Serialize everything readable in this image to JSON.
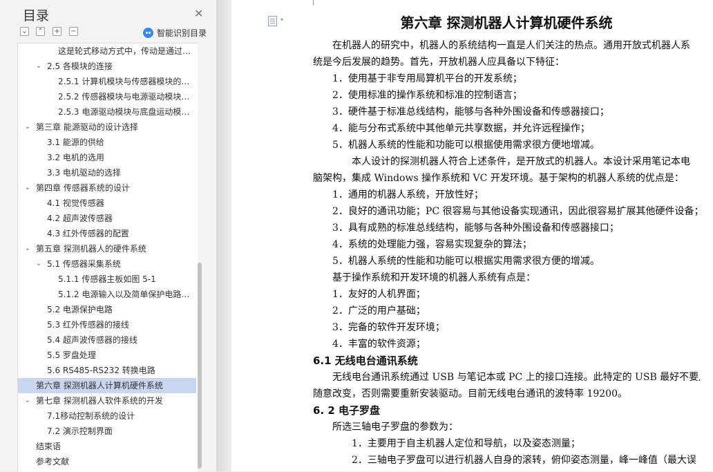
{
  "sidebar": {
    "title": "目录",
    "smart_identify_label": "智能识别目录",
    "tool_icons": [
      "collapse-all-icon",
      "expand-all-icon",
      "add-icon",
      "remove-icon"
    ],
    "items": [
      {
        "label": "这是轮式移动方式中，传动是通过…",
        "level": 3,
        "arrow": ""
      },
      {
        "label": "2.5  各模块的连接",
        "level": 1,
        "arrow": "v"
      },
      {
        "label": "2.5.1  计算机模块与传感器模块的…",
        "level": 2,
        "arrow": ""
      },
      {
        "label": "2.5.2  传感器模块与电源驱动模块…",
        "level": 2,
        "arrow": ""
      },
      {
        "label": "2.5.3 电源驱动模块与底盘运动模…",
        "level": 2,
        "arrow": ""
      },
      {
        "label": "第三章   能源驱动的设计选择",
        "level": 0,
        "arrow": "v"
      },
      {
        "label": "3.1 能源的供给",
        "level": 1,
        "arrow": ""
      },
      {
        "label": "3.2 电机的选用",
        "level": 1,
        "arrow": ""
      },
      {
        "label": "3.3 电机驱动的选择",
        "level": 1,
        "arrow": ""
      },
      {
        "label": "第四章    传感器系统的设计",
        "level": 0,
        "arrow": "v"
      },
      {
        "label": "4.1 视觉传感器",
        "level": 1,
        "arrow": ""
      },
      {
        "label": "4.2 超声波传感器",
        "level": 1,
        "arrow": ""
      },
      {
        "label": "4.3 红外传感器的配置",
        "level": 1,
        "arrow": ""
      },
      {
        "label": "第五章  探测机器人的硬件系统",
        "level": 0,
        "arrow": "v"
      },
      {
        "label": "5.1  传感器采集系统",
        "level": 1,
        "arrow": "v"
      },
      {
        "label": "5.1.1  传感器主板如图 5-1",
        "level": 2,
        "arrow": ""
      },
      {
        "label": "5.1.2  电源输入以及简单保护电路…",
        "level": 2,
        "arrow": ""
      },
      {
        "label": "5.2 电源保护电路",
        "level": 1,
        "arrow": ""
      },
      {
        "label": "5.3 红外传感器的接线",
        "level": 1,
        "arrow": ""
      },
      {
        "label": "5.4 超声波传感器的接线",
        "level": 1,
        "arrow": ""
      },
      {
        "label": "5.5 罗盘处理",
        "level": 1,
        "arrow": ""
      },
      {
        "label": "5.6 RS485-RS232 转换电路",
        "level": 1,
        "arrow": ""
      },
      {
        "label": "第六章  探测机器人计算机硬件系统",
        "level": 0,
        "arrow": "",
        "selected": true
      },
      {
        "label": "第七章    探测机器人软件系统的开发",
        "level": 0,
        "arrow": "v"
      },
      {
        "label": "7.1移动控制系统的设计",
        "level": 1,
        "arrow": ""
      },
      {
        "label": "7.2 演示控制界面",
        "level": 1,
        "arrow": ""
      },
      {
        "label": "结束语",
        "level": 0,
        "arrow": ""
      },
      {
        "label": "参考文献",
        "level": 0,
        "arrow": ""
      }
    ]
  },
  "document": {
    "chapter_title": "第六章  探测机器人计算机硬件系统",
    "lines": [
      {
        "text": "在机器人的研究中，机器人的系统结构一直是人们关注的热点。通用开放式机器人系",
        "indent": 1
      },
      {
        "text": "统是今后发展的趋势。首先，开放机器人应具备以下特征：",
        "indent": 0
      },
      {
        "text": "1．使用基于非专用局算机平台的开发系统；",
        "indent": 1
      },
      {
        "text": "2．使用标准的操作系统和标准的控制语言；",
        "indent": 1
      },
      {
        "text": "3．硬件基于标准总线结构，能够与各种外围设备和传感器接口；",
        "indent": 1
      },
      {
        "text": "4．能与分布式系统中其他单元共享数据，并允许远程操作；",
        "indent": 1
      },
      {
        "text": "5．机器人系统的性能和功能可以根据使用需求很方便地增减。",
        "indent": 1
      },
      {
        "text": "本人设计的探测机器人符合上述条件，是开放式的机器人。本设计采用笔记本电",
        "indent": 2
      },
      {
        "text": "脑架构，集成 Windows 操作系统和 VC 开发环境。基于架构的机器人系统的优点是：",
        "indent": 0
      },
      {
        "text": "1．通用的机器人系统，开放性好；",
        "indent": 1
      },
      {
        "text": "2．良好的通讯功能；PC 很容易与其他设备实现通讯，因此很容易扩展其他硬件设备；",
        "indent": 1
      },
      {
        "text": "3．具有成熟的标准总线结构，能够与各种外围设备和传感器接口；",
        "indent": 1
      },
      {
        "text": "4．系统的处理能力强，容易实现复杂的算法；",
        "indent": 1
      },
      {
        "text": "5．机器人系统的性能和功能可以根据实用需求很方便的增减。",
        "indent": 1
      },
      {
        "text": "基于操作系统和开发环境的机器人系统有点是：",
        "indent": 1
      },
      {
        "text": "1．友好的人机界面；",
        "indent": 1
      },
      {
        "text": "2．广泛的用户基础；",
        "indent": 1
      },
      {
        "text": "3．完备的软件开发环境；",
        "indent": 1
      },
      {
        "text": "4．丰富的软件资源；",
        "indent": 1
      },
      {
        "text": "6.1 无线电台通讯系统",
        "indent": 0,
        "heading": true
      },
      {
        "text": "无线电台通讯系统通过 USB 与笔记本或 PC 上的接口连接。此特定的 USB 最好不要用",
        "indent": 1
      },
      {
        "text": "随意改变，否则需要重新安装驱动。目前无线电台通讯的波特率 19200。",
        "indent": 0
      },
      {
        "text": "6. 2 电子罗盘",
        "indent": 0,
        "heading": true
      },
      {
        "text": "所选三轴电子罗盘的参数为：",
        "indent": 1
      },
      {
        "text": "1．主要用于自主机器人定位和导航，以及姿态测量；",
        "indent": 3
      },
      {
        "text": "2．三轴电子罗盘可以进行机器人自身的滚转，俯仰姿态测量，峰一峰值（最大误",
        "indent": 3
      }
    ]
  }
}
